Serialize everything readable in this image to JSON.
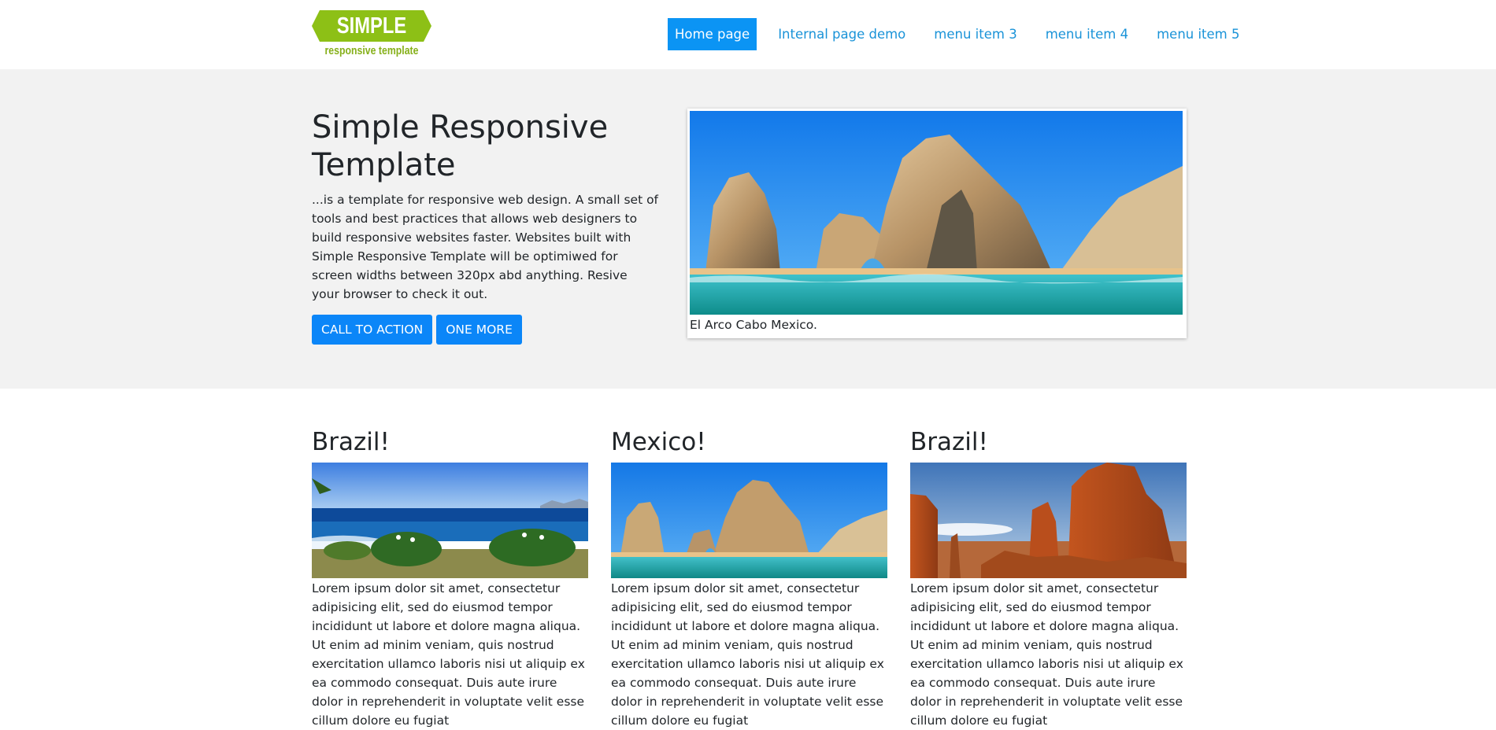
{
  "header": {
    "logo": {
      "word": "SIMPLE",
      "tagline": "responsive template"
    },
    "nav": [
      {
        "label": "Home page",
        "active": true
      },
      {
        "label": "Internal page demo",
        "active": false
      },
      {
        "label": "menu item 3",
        "active": false
      },
      {
        "label": "menu item 4",
        "active": false
      },
      {
        "label": "menu item 5",
        "active": false
      }
    ]
  },
  "hero": {
    "title": "Simple Responsive Template",
    "text": "...is a template for responsive web design. A small set of tools and best practices that allows web designers to build responsive websites faster. Websites built with Simple Responsive Template will be optimiwed for screen widths between 320px abd anything. Resive your browser to check it out.",
    "buttons": [
      "CALL TO ACTION",
      "ONE MORE"
    ],
    "caption": "El Arco Cabo Mexico."
  },
  "cards": [
    {
      "title": "Brazil!",
      "text": "Lorem ipsum dolor sit amet, consectetur adipisicing elit, sed do eiusmod tempor incididunt ut labore et dolore magna aliqua. Ut enim ad minim veniam, quis nostrud exercitation ullamco laboris nisi ut aliquip ex ea commodo consequat. Duis aute irure dolor in reprehenderit in voluptate velit esse cillum dolore eu fugiat"
    },
    {
      "title": "Mexico!",
      "text": "Lorem ipsum dolor sit amet, consectetur adipisicing elit, sed do eiusmod tempor incididunt ut labore et dolore magna aliqua. Ut enim ad minim veniam, quis nostrud exercitation ullamco laboris nisi ut aliquip ex ea commodo consequat. Duis aute irure dolor in reprehenderit in voluptate velit esse cillum dolore eu fugiat"
    },
    {
      "title": "Brazil!",
      "text": "Lorem ipsum dolor sit amet, consectetur adipisicing elit, sed do eiusmod tempor incididunt ut labore et dolore magna aliqua. Ut enim ad minim veniam, quis nostrud exercitation ullamco laboris nisi ut aliquip ex ea commodo consequat. Duis aute irure dolor in reprehenderit in voluptate velit esse cillum dolore eu fugiat"
    }
  ],
  "colors": {
    "logo_green": "#8dc016",
    "nav_link": "#1a93d8",
    "nav_active_bg": "#0b94f4",
    "button_bg": "#0b86f8",
    "hero_bg": "#f2f2f2"
  }
}
